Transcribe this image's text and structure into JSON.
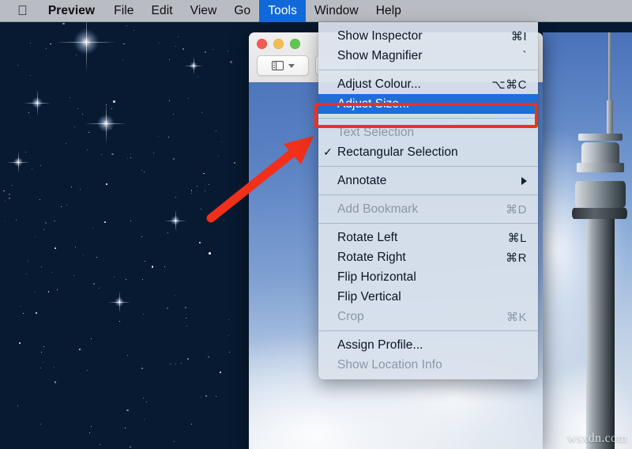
{
  "menubar": {
    "apple_glyph": "",
    "items": [
      {
        "label": "Preview",
        "bold": true,
        "active": false
      },
      {
        "label": "File",
        "bold": false,
        "active": false
      },
      {
        "label": "Edit",
        "bold": false,
        "active": false
      },
      {
        "label": "View",
        "bold": false,
        "active": false
      },
      {
        "label": "Go",
        "bold": false,
        "active": false
      },
      {
        "label": "Tools",
        "bold": false,
        "active": true
      },
      {
        "label": "Window",
        "bold": false,
        "active": false
      },
      {
        "label": "Help",
        "bold": false,
        "active": false
      }
    ]
  },
  "tools_menu": {
    "groups": [
      {
        "items": [
          {
            "label": "Show Inspector",
            "shortcut": "⌘I",
            "disabled": false,
            "checked": false,
            "selected": false,
            "submenu": false
          },
          {
            "label": "Show Magnifier",
            "shortcut": "`",
            "disabled": false,
            "checked": false,
            "selected": false,
            "submenu": false
          }
        ]
      },
      {
        "items": [
          {
            "label": "Adjust Colour...",
            "shortcut": "⌥⌘C",
            "disabled": false,
            "checked": false,
            "selected": false,
            "submenu": false
          },
          {
            "label": "Adjust Size...",
            "shortcut": "",
            "disabled": false,
            "checked": false,
            "selected": true,
            "submenu": false
          }
        ]
      },
      {
        "items": [
          {
            "label": "Text Selection",
            "shortcut": "",
            "disabled": true,
            "checked": false,
            "selected": false,
            "submenu": false
          },
          {
            "label": "Rectangular Selection",
            "shortcut": "",
            "disabled": false,
            "checked": true,
            "selected": false,
            "submenu": false
          }
        ]
      },
      {
        "items": [
          {
            "label": "Annotate",
            "shortcut": "",
            "disabled": false,
            "checked": false,
            "selected": false,
            "submenu": true
          }
        ]
      },
      {
        "items": [
          {
            "label": "Add Bookmark",
            "shortcut": "⌘D",
            "disabled": true,
            "checked": false,
            "selected": false,
            "submenu": false
          }
        ]
      },
      {
        "items": [
          {
            "label": "Rotate Left",
            "shortcut": "⌘L",
            "disabled": false,
            "checked": false,
            "selected": false,
            "submenu": false
          },
          {
            "label": "Rotate Right",
            "shortcut": "⌘R",
            "disabled": false,
            "checked": false,
            "selected": false,
            "submenu": false
          },
          {
            "label": "Flip Horizontal",
            "shortcut": "",
            "disabled": false,
            "checked": false,
            "selected": false,
            "submenu": false
          },
          {
            "label": "Flip Vertical",
            "shortcut": "",
            "disabled": false,
            "checked": false,
            "selected": false,
            "submenu": false
          },
          {
            "label": "Crop",
            "shortcut": "⌘K",
            "disabled": true,
            "checked": false,
            "selected": false,
            "submenu": false
          }
        ]
      },
      {
        "items": [
          {
            "label": "Assign Profile...",
            "shortcut": "",
            "disabled": false,
            "checked": false,
            "selected": false,
            "submenu": false
          },
          {
            "label": "Show Location Info",
            "shortcut": "",
            "disabled": true,
            "checked": false,
            "selected": false,
            "submenu": false
          }
        ]
      }
    ]
  },
  "window": {
    "traffic_lights": [
      {
        "name": "close",
        "color": "#f25b54"
      },
      {
        "name": "minimize",
        "color": "#f4bd4f"
      },
      {
        "name": "zoom",
        "color": "#61c454"
      }
    ],
    "toolbar": {
      "sidebar_button_label": "",
      "second_button_label": ""
    }
  },
  "annotation": {
    "highlight_color": "#f0301a",
    "selection_color": "#1a6fda",
    "arrow_target": "Adjust Size..."
  },
  "watermark": {
    "text": "wsxdn.com"
  }
}
